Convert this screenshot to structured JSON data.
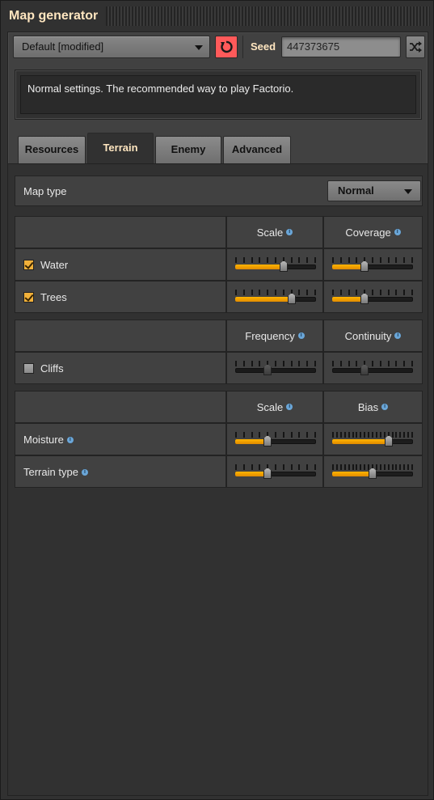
{
  "window": {
    "title": "Map generator"
  },
  "preset": {
    "value": "Default [modified]"
  },
  "seed": {
    "label": "Seed",
    "value": "447373675"
  },
  "description": "Normal settings. The recommended way to play Factorio.",
  "tabs": [
    {
      "label": "Resources",
      "active": false
    },
    {
      "label": "Terrain",
      "active": true
    },
    {
      "label": "Enemy",
      "active": false
    },
    {
      "label": "Advanced",
      "active": false
    }
  ],
  "map_type": {
    "label": "Map type",
    "value": "Normal"
  },
  "water_trees": {
    "headers": {
      "scale": "Scale",
      "coverage": "Coverage"
    },
    "rows": [
      {
        "label": "Water",
        "checked": true,
        "scale": 0.6,
        "coverage": 0.4
      },
      {
        "label": "Trees",
        "checked": true,
        "scale": 0.7,
        "coverage": 0.4
      }
    ]
  },
  "cliffs": {
    "headers": {
      "frequency": "Frequency",
      "continuity": "Continuity"
    },
    "row": {
      "label": "Cliffs",
      "checked": false,
      "frequency": 0.4,
      "continuity": 0.4
    }
  },
  "moisture_terrain": {
    "headers": {
      "scale": "Scale",
      "bias": "Bias"
    },
    "rows": [
      {
        "label": "Moisture",
        "scale": 0.4,
        "bias": 0.7
      },
      {
        "label": "Terrain type",
        "scale": 0.4,
        "bias": 0.5
      }
    ]
  },
  "colors": {
    "accent": "#ffb400",
    "title": "#ffe6c0",
    "reset": "#ff5a5a",
    "info": "#6aa6d8"
  },
  "icons": {
    "reset": "reset-arrow-icon",
    "shuffle": "shuffle-icon",
    "info": "info-icon",
    "dropdown": "chevron-down-icon"
  }
}
